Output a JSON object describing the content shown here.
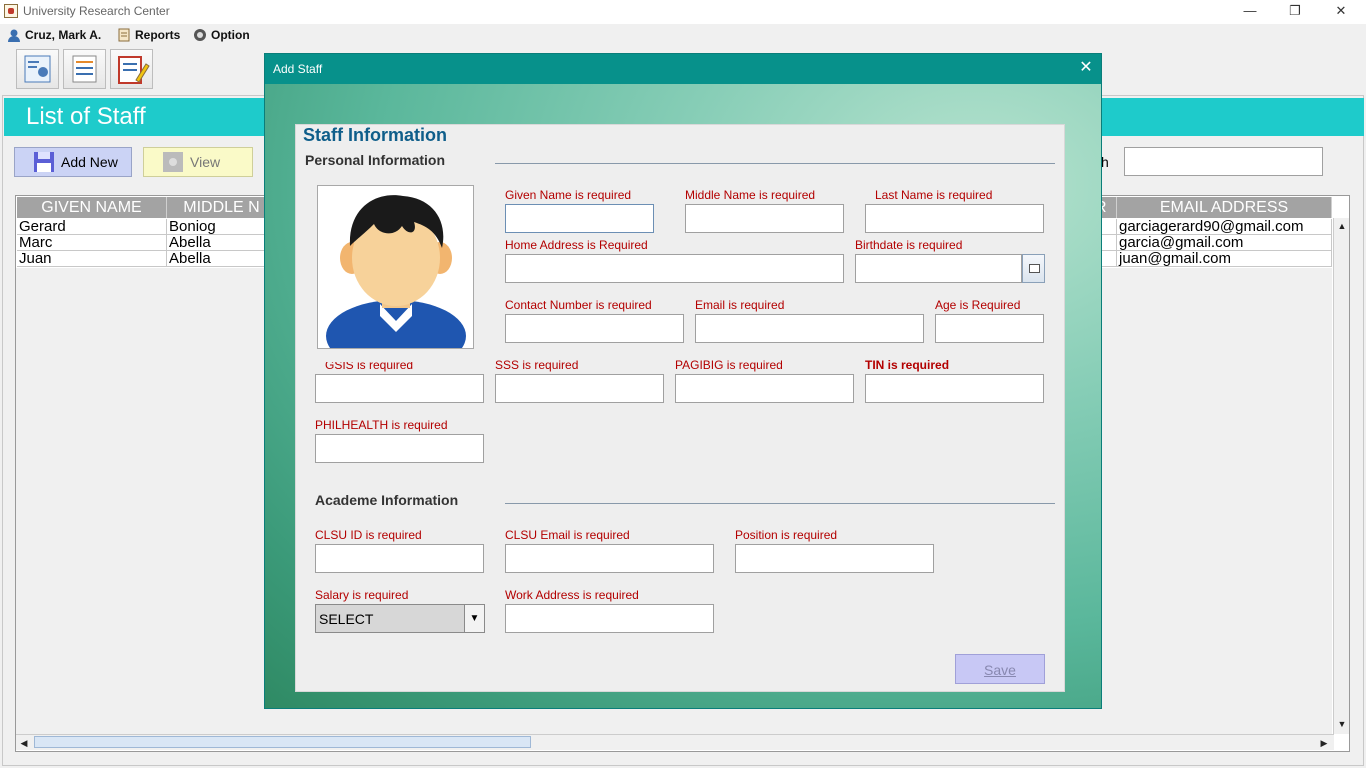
{
  "window": {
    "title": "University Research Center",
    "minimize": "—",
    "restore": "❐",
    "close": "✕"
  },
  "menu": {
    "user": "Cruz, Mark A.",
    "reports": "Reports",
    "option": "Option"
  },
  "page": {
    "header": "List of Staff",
    "add_new": "Add New",
    "view": "View",
    "search_label": "h"
  },
  "table": {
    "columns": [
      "GIVEN NAME",
      "MIDDLE N",
      "R",
      "EMAIL ADDRESS"
    ],
    "rows": [
      {
        "given": "Gerard",
        "middle": "Boniog",
        "email": "garciagerard90@gmail.com"
      },
      {
        "given": "Marc",
        "middle": "Abella",
        "email": "garcia@gmail.com"
      },
      {
        "given": "Juan",
        "middle": "Abella",
        "email": "juan@gmail.com"
      }
    ]
  },
  "dialog": {
    "title": "Add Staff",
    "close": "✕",
    "legend": "Staff Information",
    "personal_title": "Personal Information",
    "academe_title": "Academe Information",
    "labels": {
      "given_name": "Given Name is required",
      "middle_name": "Middle Name is required",
      "last_name": "Last Name is required",
      "home_address": "Home Address is Required",
      "birthdate": "Birthdate is required",
      "contact": "Contact Number is required",
      "email": "Email is required",
      "age": "Age is Required",
      "gsis": "GSIS is required",
      "sss": "SSS is required",
      "pagibig": "PAGIBIG is required",
      "tin": "TIN is required",
      "philhealth": "PHILHEALTH is required",
      "clsu_id": "CLSU ID is required",
      "clsu_email": "CLSU Email is required",
      "position": "Position is required",
      "salary": "Salary is required",
      "work_address": "Work Address is required"
    },
    "salary_value": "SELECT",
    "save": "Save"
  },
  "colors": {
    "accent": "#1ecbcb",
    "dialog_title": "#07918b",
    "error": "#b30000",
    "legend": "#0f5e8a"
  },
  "icons": [
    "user-icon",
    "reports-icon",
    "option-gear-icon",
    "staff-list-icon",
    "records-icon",
    "tasks-icon",
    "save-disk-icon",
    "view-icon",
    "calendar-icon",
    "avatar-icon"
  ]
}
